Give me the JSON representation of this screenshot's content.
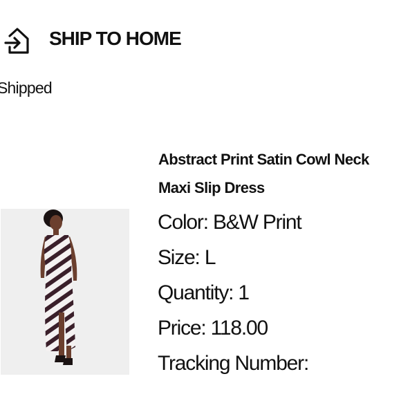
{
  "header": {
    "icon": "home-delivery-icon",
    "title": "SHIP TO HOME"
  },
  "order": {
    "status": "Shipped"
  },
  "product": {
    "name_line1": "Abstract Print Satin Cowl Neck",
    "name_line2": "Maxi Slip Dress",
    "image_icon": "dress-photo",
    "details": [
      {
        "label": "Color:",
        "value": "B&W Print"
      },
      {
        "label": "Size:",
        "value": "L"
      },
      {
        "label": "Quantity:",
        "value": "1"
      },
      {
        "label": "Price:",
        "value": "118.00"
      },
      {
        "label": "Tracking Number:",
        "value": ""
      }
    ]
  }
}
